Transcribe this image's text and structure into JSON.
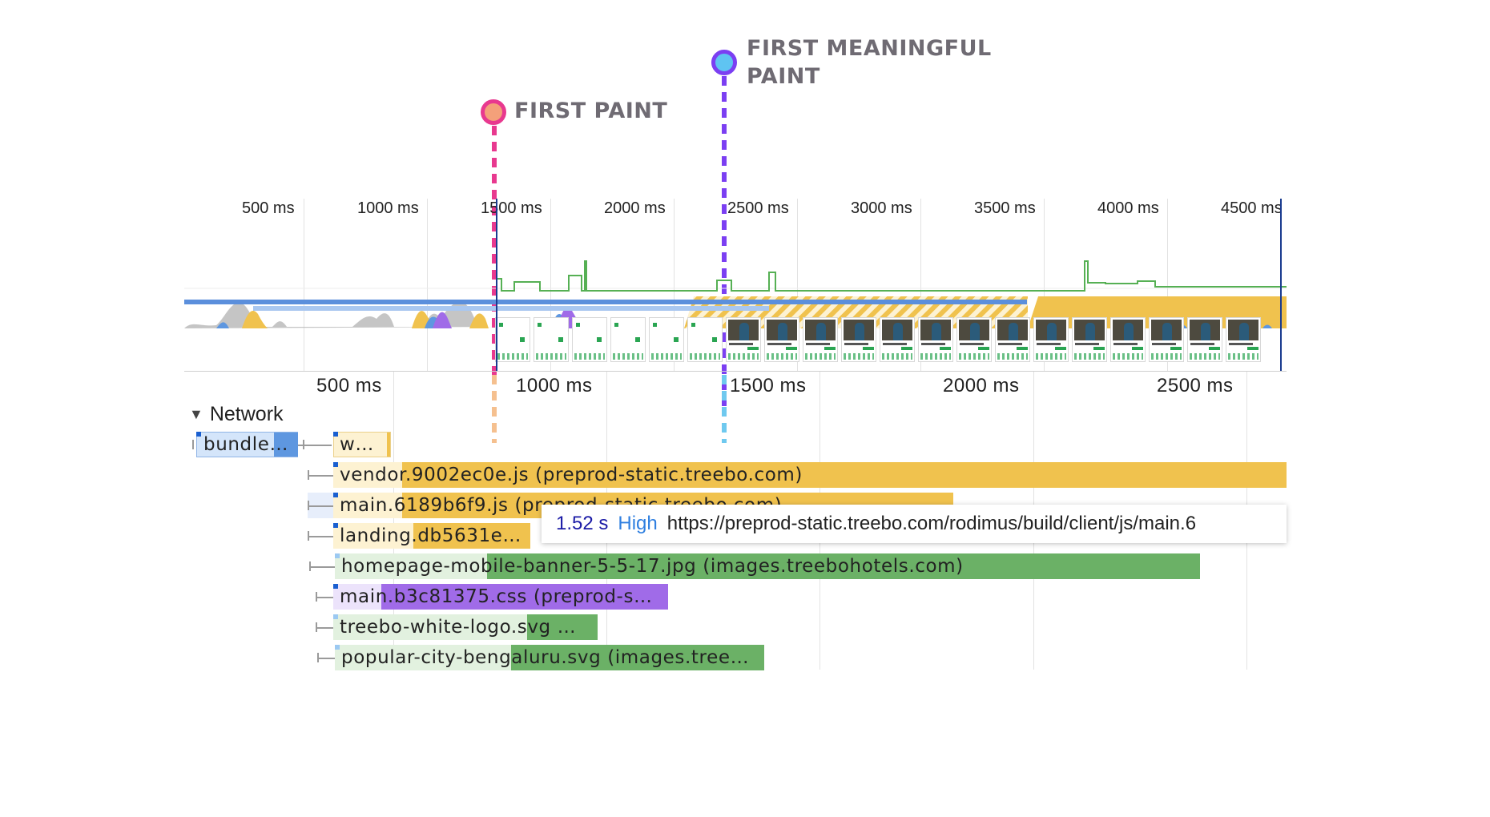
{
  "markers": {
    "first_paint": {
      "label": "FIRST PAINT",
      "color": "#e8398f",
      "fill": "#f4a07a"
    },
    "first_meaningful_paint": {
      "label_line1": "FIRST MEANINGFUL",
      "label_line2": "PAINT",
      "color": "#7b3ff2",
      "fill": "#5fc4f2"
    }
  },
  "overview": {
    "ticks": [
      "500 ms",
      "1000 ms",
      "1500 ms",
      "2000 ms",
      "2500 ms",
      "3000 ms",
      "3500 ms",
      "4000 ms",
      "4500 ms"
    ]
  },
  "ruler": {
    "ticks": [
      "500 ms",
      "1000 ms",
      "1500 ms",
      "2000 ms",
      "2500 ms"
    ]
  },
  "network": {
    "section_label": "Network",
    "rows": [
      {
        "label": "bundle…",
        "label2": "w…"
      },
      {
        "label": "vendor.9002ec0e.js (preprod-static.treebo.com)"
      },
      {
        "label": "main.6189b6f9.js (preprod-static.treebo.com)"
      },
      {
        "label": "landing.db5631e…"
      },
      {
        "label": "homepage-mobile-banner-5-5-17.jpg (images.treebohotels.com)"
      },
      {
        "label": "main.b3c81375.css (preprod-s…"
      },
      {
        "label": "treebo-white-logo.svg …"
      },
      {
        "label": "popular-city-bengaluru.svg (images.tree…"
      }
    ]
  },
  "tooltip": {
    "duration": "1.52 s",
    "priority": "High",
    "url": "https://preprod-static.treebo.com/rodimus/build/client/js/main.6"
  },
  "colors": {
    "script": "#f0c24e",
    "script_light": "#fdf2d2",
    "image": "#6bb166",
    "image_light": "#e2f1df",
    "style": "#a06be8",
    "style_light": "#ece3fb",
    "document": "#5e97e0",
    "document_light": "#d4e5fa",
    "main_track": "#5b8fdc",
    "main_track_light": "#a9c7f0"
  }
}
